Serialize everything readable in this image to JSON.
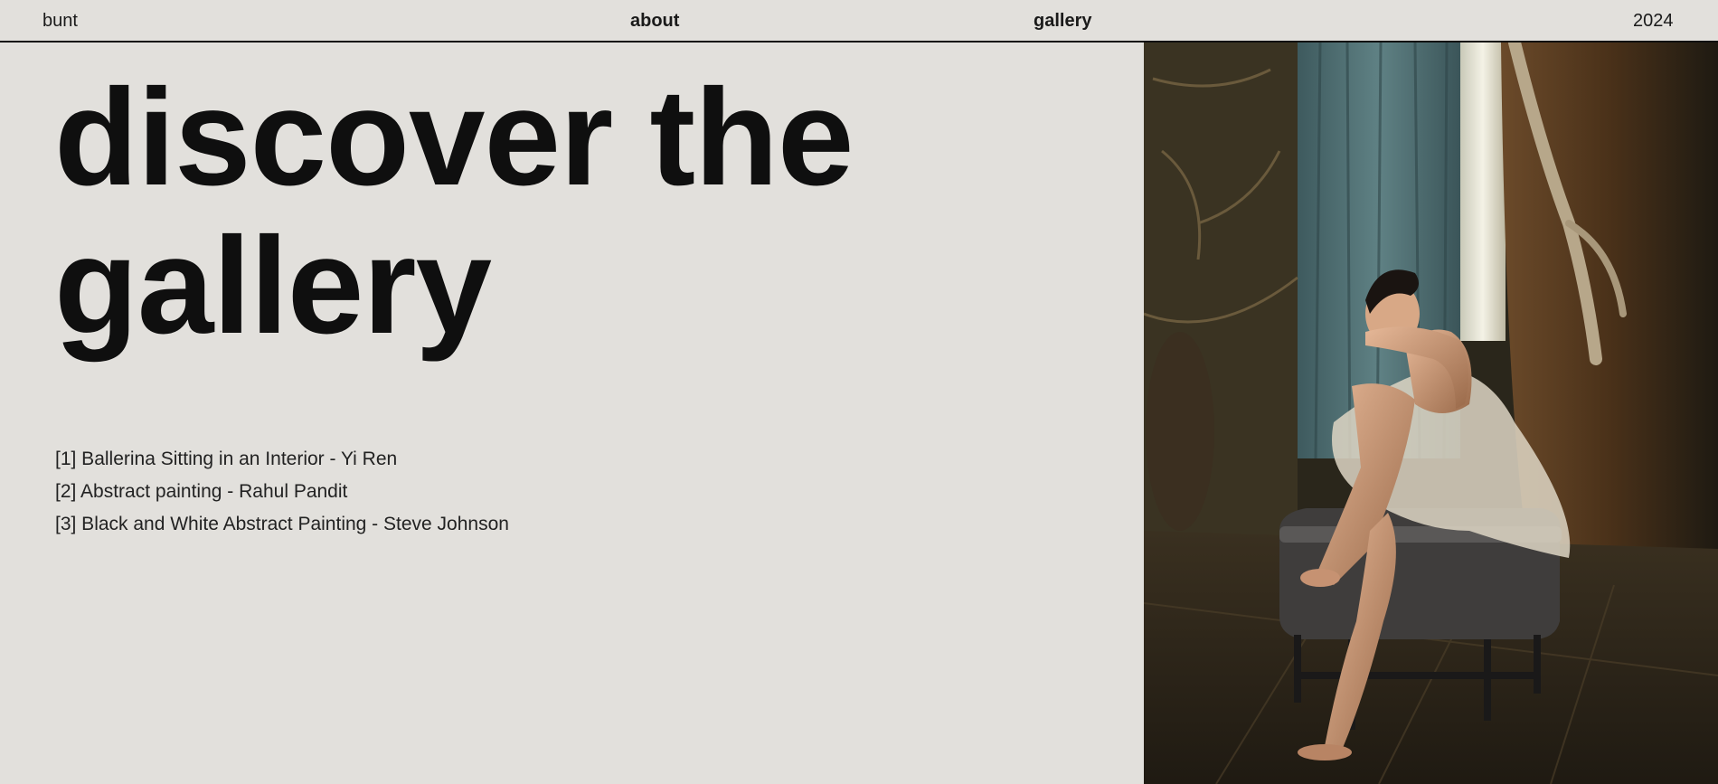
{
  "nav": {
    "brand": "bunt",
    "about": "about",
    "gallery": "gallery",
    "year": "2024"
  },
  "hero": {
    "line1": "discover the",
    "line2": "gallery"
  },
  "credits": [
    "[1] Ballerina Sitting in an Interior - Yi Ren",
    "[2] Abstract painting - Rahul Pandit",
    "[3] Black and White Abstract Painting - Steve Johnson"
  ],
  "colors": {
    "background": "#e2e0dc",
    "text": "#111111"
  },
  "photo": {
    "subject": "ballerina-sitting-in-interior"
  }
}
